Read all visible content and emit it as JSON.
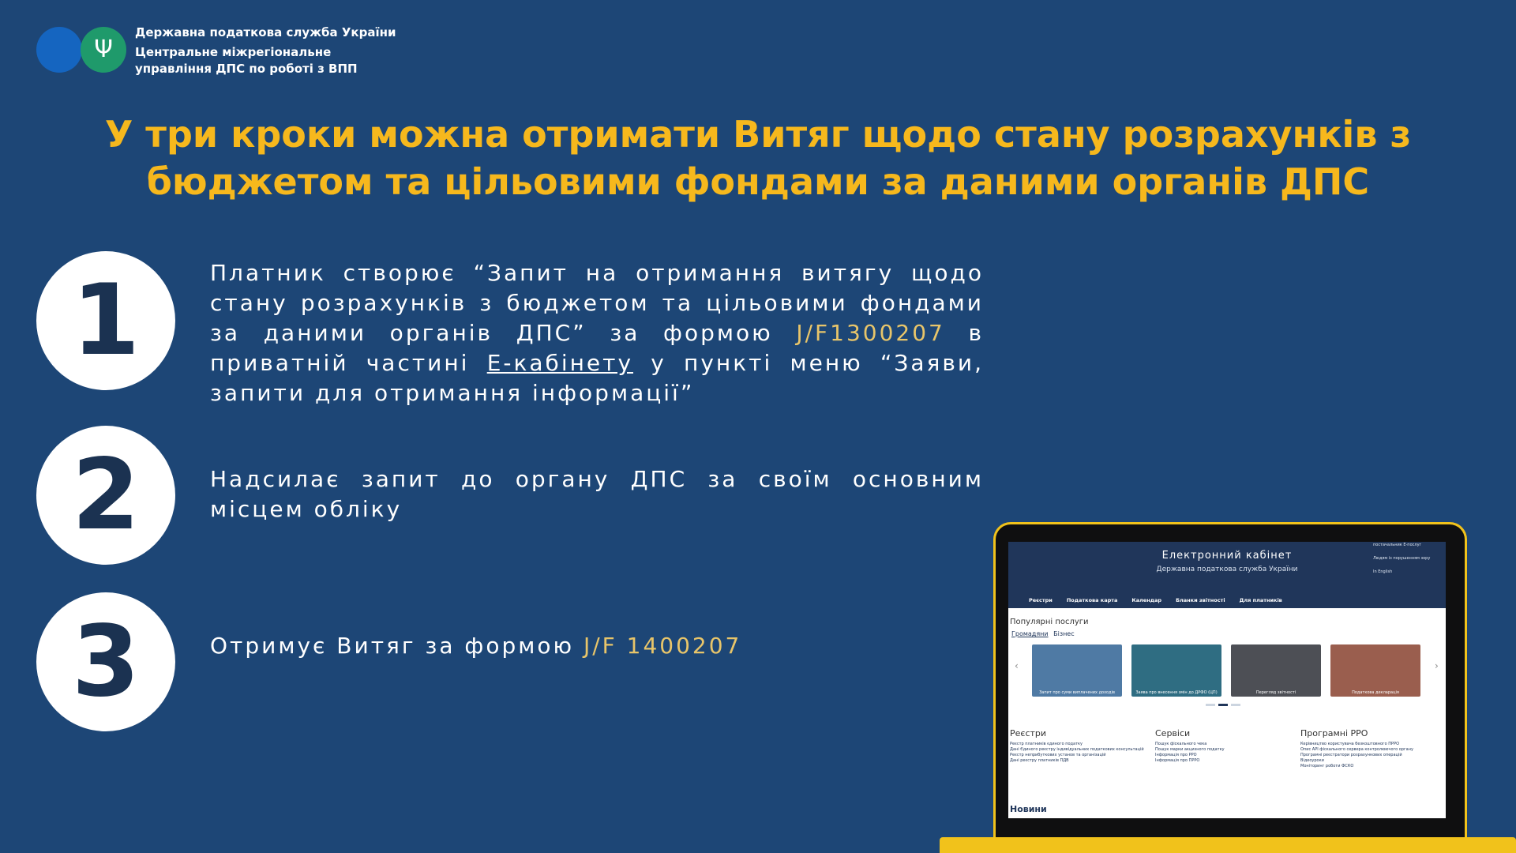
{
  "header": {
    "org_line1": "Державна податкова служба України",
    "org_line2": "Центральне міжрегіональне",
    "org_line3": "управління ДПС по роботі з ВПП"
  },
  "title": {
    "line1": "У три кроки можна отримати Витяг щодо стану розрахунків з",
    "line2": "бюджетом та цільовими фондами за даними органів ДПС"
  },
  "steps": [
    {
      "number": "1",
      "text_a": "Платник створює “Запит на отримання витягу щодо стану розрахунків з бюджетом та цільовими фондами за даними органів ДПС” за формою ",
      "form": "J/F1300207",
      "text_b": " в приватній частині ",
      "link": "Е-кабінету",
      "text_c": " у пункті меню “Заяви, запити для отримання інформації”"
    },
    {
      "number": "2",
      "text": "Надсилає запит до органу ДПС за своїм основним місцем обліку"
    },
    {
      "number": "3",
      "text_a": "Отримує Витяг за формою ",
      "form": "J/F 1400207"
    }
  ],
  "screen": {
    "title": "Електронний кабінет",
    "subtitle": "Державна податкова служба України",
    "side": [
      "постачальник Е-послуг",
      "Людям із порушенням зору",
      "In English"
    ],
    "nav": [
      "Реєстри",
      "Податкова карта",
      "Календар",
      "Бланки звітності",
      "Для платників"
    ],
    "popular": "Популярні послуги",
    "tab_active": "Громадяни",
    "tab_other": "Бізнес",
    "cards": [
      "Запит про суми виплачених доходів",
      "Заява про внесення змін до ДРФО (ЦП)",
      "Перегляд звітності",
      "Податкова декларація"
    ],
    "col1_title": "Реєстри",
    "col1": [
      "Реєстр платників єдиного податку",
      "Дані Єдиного реєстру індивідуальних податкових консультацій",
      "Реєстр неприбуткових установ та організацій",
      "Дані реєстру платників ПДВ"
    ],
    "col2_title": "Сервіси",
    "col2": [
      "Пошук фіскального чека",
      "Пошук марки акцизного податку",
      "Інформація про РРО",
      "Інформація про ПРРО"
    ],
    "col3_title": "Програмні РРО",
    "col3": [
      "Керівництво користувача безкоштовного ПРРО",
      "Опис API фіскального сервера контролюючого органу",
      "Програмні реєстратори розрахункових операцій",
      "Відеоуроки",
      "Моніторинг роботи ФСКО"
    ],
    "news": "Новини"
  },
  "colors": {
    "background": "#1d4676",
    "title": "#f6b81d",
    "highlight": "#e8c56a",
    "laptop_frame": "#f1c21b"
  }
}
